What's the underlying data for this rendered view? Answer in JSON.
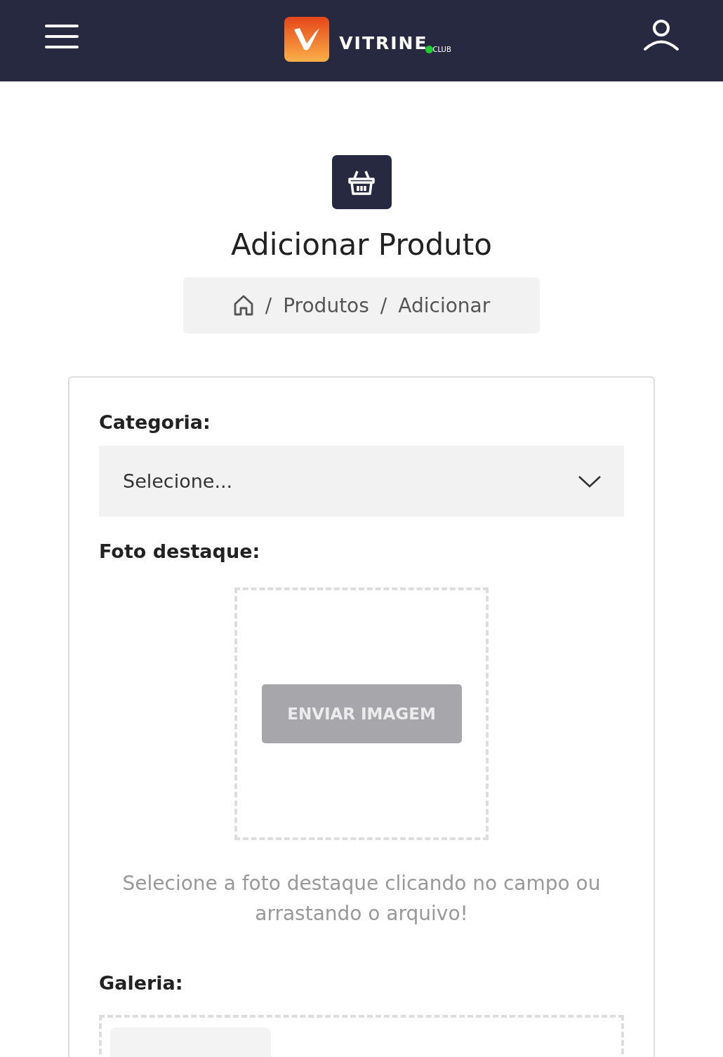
{
  "header": {
    "logo": {
      "name": "VITRINE",
      "suffix": "CLUB"
    }
  },
  "page": {
    "title": "Adicionar Produto"
  },
  "breadcrumb": [
    {
      "separator": "/",
      "label": "Produtos"
    },
    {
      "separator": "/",
      "label": "Adicionar"
    }
  ],
  "form": {
    "category": {
      "label": "Categoria:",
      "placeholder": "Selecione..."
    },
    "featured_photo": {
      "label": "Foto destaque:",
      "button": "ENVIAR IMAGEM",
      "disabled": true,
      "help": "Selecione a foto destaque clicando no campo ou arrastando o arquivo!"
    },
    "gallery": {
      "label": "Galeria:"
    }
  }
}
